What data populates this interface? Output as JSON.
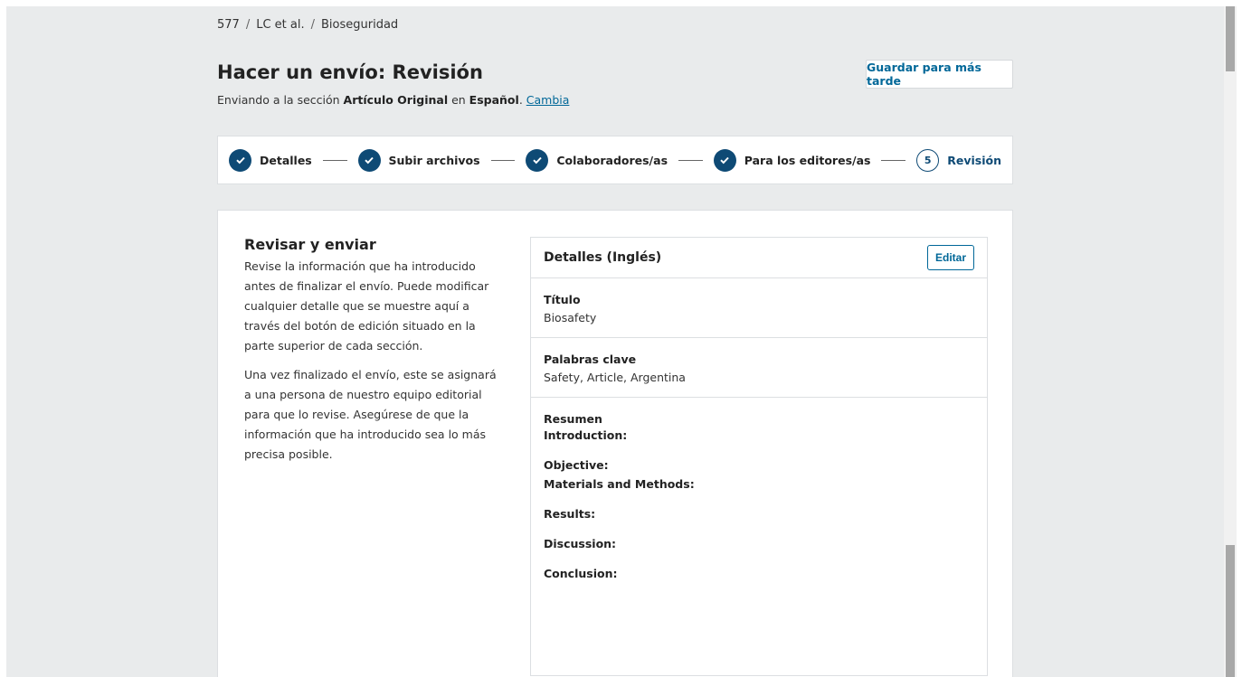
{
  "breadcrumb": {
    "id": "577",
    "authors": "LC et al.",
    "section": "Bioseguridad",
    "separator": "/"
  },
  "header": {
    "title": "Hacer un envío: Revisión",
    "subtitle_prefix": "Enviando a la sección ",
    "subtitle_section": "Artículo Original",
    "subtitle_mid": " en ",
    "subtitle_language": "Español",
    "subtitle_dot": ". ",
    "change_link": "Cambia",
    "save_later": "Guardar para más tarde"
  },
  "steps": [
    {
      "label": "Detalles",
      "state": "done"
    },
    {
      "label": "Subir archivos",
      "state": "done"
    },
    {
      "label": "Colaboradores/as",
      "state": "done"
    },
    {
      "label": "Para los editores/as",
      "state": "done"
    },
    {
      "label": "Revisión",
      "state": "current",
      "number": "5"
    }
  ],
  "intro": {
    "heading": "Revisar y enviar",
    "p1": "Revise la información que ha introducido antes de finalizar el envío. Puede modificar cualquier detalle que se muestre aquí a través del botón de edición situado en la parte superior de cada sección.",
    "p2": "Una vez finalizado el envío, este se asignará a una persona de nuestro equipo editorial para que lo revise. Asegúrese de que la información que ha introducido sea lo más precisa posible."
  },
  "details": {
    "heading": "Detalles (Inglés)",
    "edit_label": "Editar",
    "title_label": "Título",
    "title_value": "Biosafety",
    "keywords_label": "Palabras clave",
    "keywords_value": "Safety, Article, Argentina",
    "abstract_label": "Resumen",
    "abstract_lines": [
      "Introduction:",
      "Objective:",
      "Materials and Methods:",
      "Results:",
      "Discussion:",
      "Conclusion:"
    ]
  },
  "colors": {
    "primary": "#0e4a75",
    "link": "#006798",
    "background": "#e9ebec"
  }
}
